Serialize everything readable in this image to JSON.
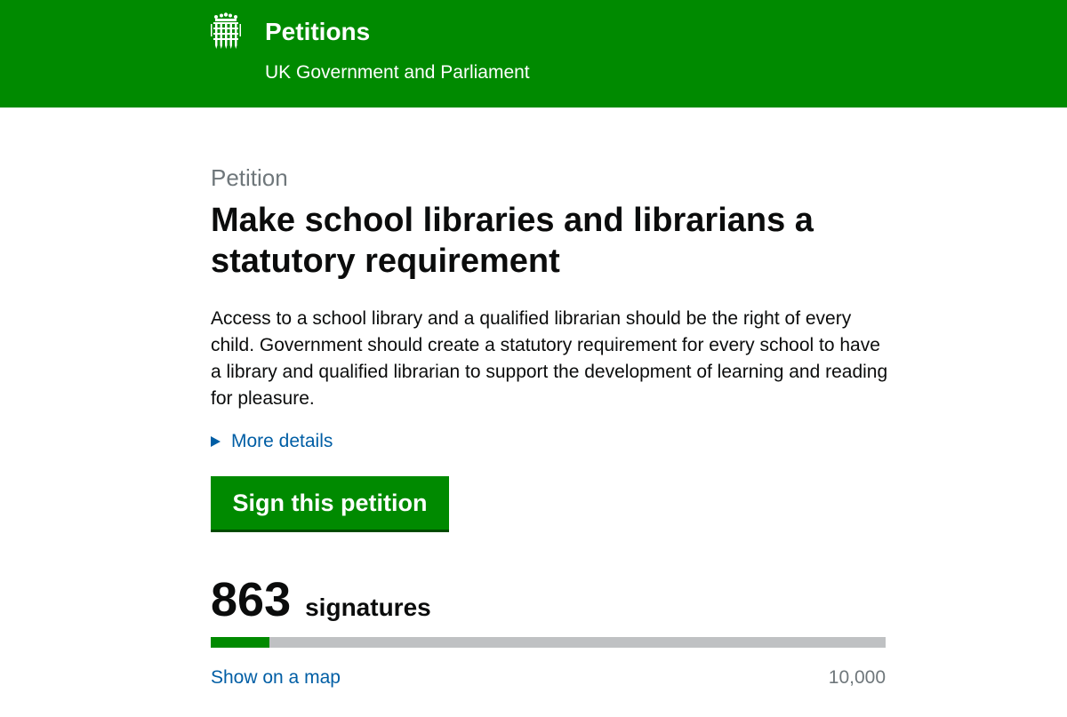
{
  "header": {
    "title": "Petitions",
    "subtitle": "UK Government and Parliament",
    "logo_icon": "portcullis-icon",
    "background": "#008a00"
  },
  "petition": {
    "kicker": "Petition",
    "title": "Make school libraries and librarians a statutory requirement",
    "summary": "Access to a school library and a qualified librarian should be the right of every child. Government should create a statutory requirement for every school to have a library and qualified librarian to support the development of learning and reading for pleasure.",
    "more_details_label": "More details",
    "sign_button_label": "Sign this petition"
  },
  "signatures": {
    "count": "863",
    "label": "signatures",
    "target": "10,000",
    "progress_fraction": 0.0863,
    "show_map_label": "Show on a map"
  },
  "colors": {
    "brand_green": "#008a00",
    "link_blue": "#005ea5",
    "secondary_text": "#6f777b",
    "progress_track": "#bfc1c3"
  }
}
